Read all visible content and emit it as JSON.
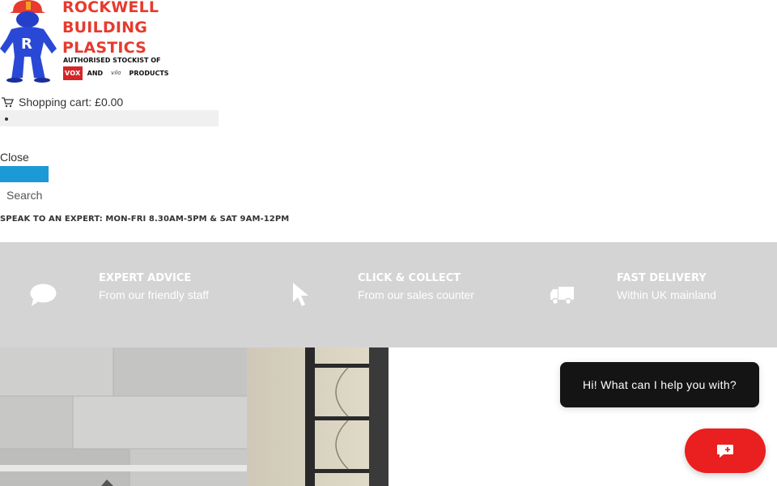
{
  "logo": {
    "name_lines": [
      "ROCKWELL",
      "BUILDING",
      "PLASTICS"
    ],
    "tagline": "AUTHORISED STOCKIST OF",
    "brand1": "VOX",
    "and": "AND",
    "brand2": "vilo",
    "products": "PRODUCTS"
  },
  "cart": {
    "label": "Shopping cart: £0.00"
  },
  "close_label": "Close",
  "search": {
    "placeholder": "Search"
  },
  "expert_line": "SPEAK TO AN EXPERT: MON-FRI 8.30AM-5PM & SAT 9AM-12PM",
  "features": [
    {
      "title": "EXPERT ADVICE",
      "subtitle": "From our friendly staff",
      "icon": "chat-icon"
    },
    {
      "title": "CLICK & COLLECT",
      "subtitle": "From our sales counter",
      "icon": "cursor-icon"
    },
    {
      "title": "FAST DELIVERY",
      "subtitle": "Within UK mainland",
      "icon": "truck-icon"
    }
  ],
  "chat": {
    "message": "Hi! What can I help you with?"
  },
  "colors": {
    "brand_red": "#e63b2e",
    "accent_blue": "#1b9ad6",
    "feature_band": "#d4d4d4",
    "chat_button": "#ea1f1f"
  }
}
